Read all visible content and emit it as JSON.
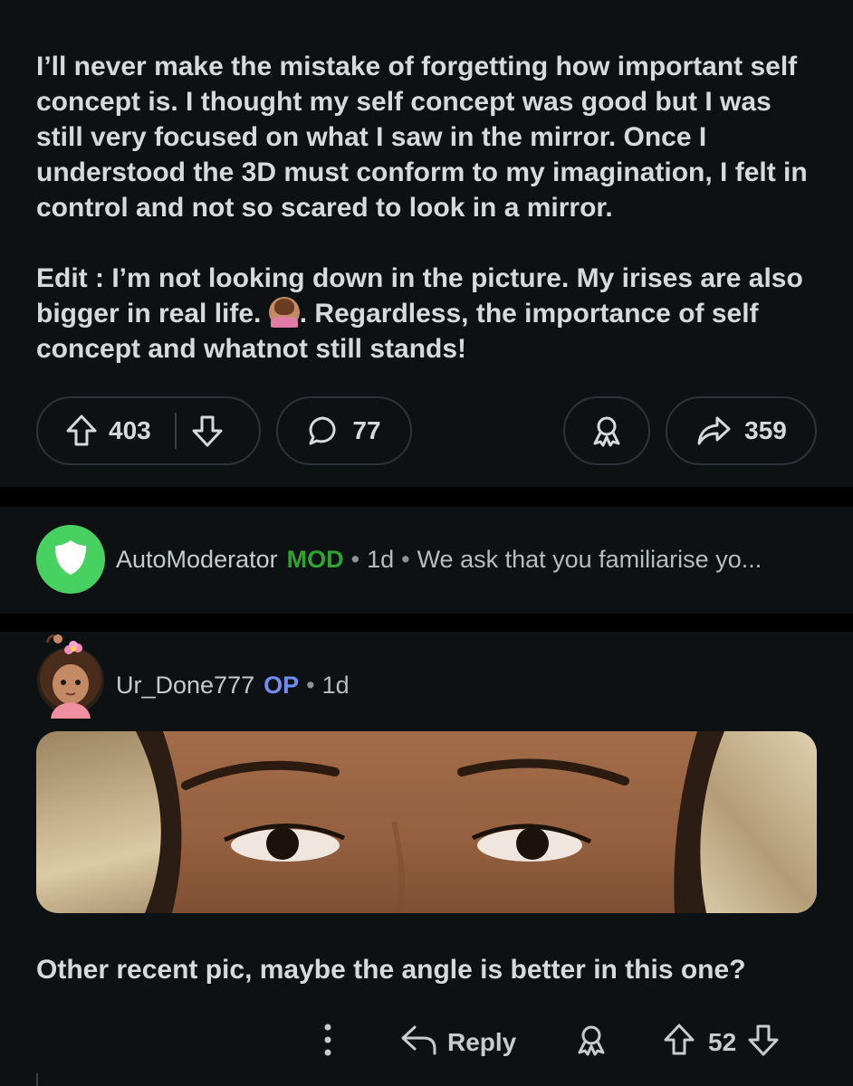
{
  "post": {
    "body_paragraph_1": "I’ll never make the mistake of forgetting how important self concept is. I thought my self concept was good but I was still very focused on what I saw in the mirror. Once I understood the 3D must conform to my imagination, I felt in control and not so scared to look in a mirror.",
    "body_paragraph_2_before_emoji": "Edit : I’m not looking down in the picture. My irises are also bigger in real life. ",
    "body_paragraph_2_emoji": "person-shrugging-emoji",
    "body_paragraph_2_after_emoji": ". Regardless, the importance of self concept and whatnot still stands!",
    "upvotes": "403",
    "comments": "77",
    "shares": "359"
  },
  "automod_comment": {
    "username": "AutoModerator",
    "badge": "MOD",
    "age": "1d",
    "preview": "We ask that you familiarise yo...",
    "avatar_icon": "shield-icon",
    "avatar_color": "#46d160"
  },
  "reply_comment": {
    "username": "Ur_Done777",
    "badge": "OP",
    "age": "1d",
    "body": "Other recent pic, maybe the angle is better in this one?",
    "reply_label": "Reply",
    "votes": "52",
    "image": "close-up photo of eyes and eyebrows"
  },
  "colors": {
    "background": "#0e1113",
    "mod_green": "#2fa52f",
    "op_blue": "#6f8df2",
    "text": "#d7dadc"
  },
  "separator": "•"
}
